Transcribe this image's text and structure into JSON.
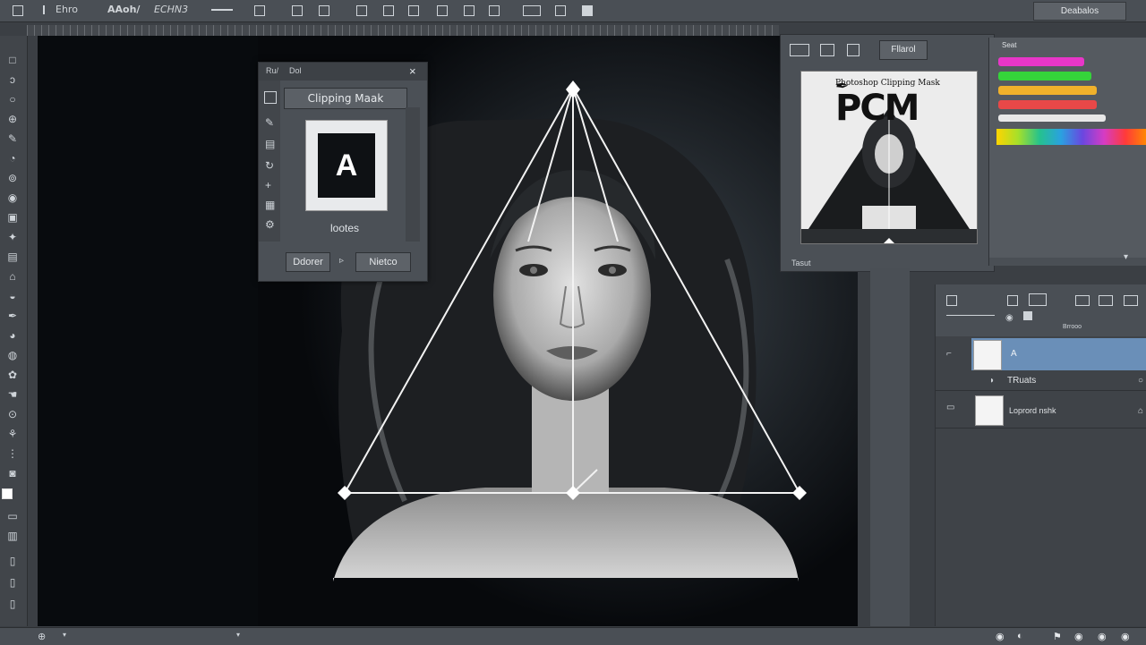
{
  "topbar": {
    "items": [
      "Ehro",
      "AAoh/",
      "ECHN3"
    ],
    "workspace_button": "Deabalos"
  },
  "dialog": {
    "tab_left": "Ru/",
    "tab_right": "Dol",
    "close": "×",
    "title": "Clipping Maak",
    "preview_letter": "A",
    "caption": "lootes",
    "button_left": "Ddorer",
    "button_mid": "▹",
    "button_right": "Nietco"
  },
  "clip_panel": {
    "tab_label": "Fllarol",
    "logo_title": "Photoshop Clipping Mask",
    "logo_text": "PCM",
    "footer": "Tasut"
  },
  "color_panel": {
    "title": "Seat",
    "swatches": [
      "#e836c8",
      "#35d43a",
      "#f0b12b",
      "#e84848",
      "#e8e8e8"
    ]
  },
  "layers": {
    "header_label": "Brrooo",
    "rows": [
      {
        "name": "A",
        "selected": true
      },
      {
        "name": "TRuats",
        "selected": false
      },
      {
        "name": "Loprord nshk",
        "selected": false
      }
    ]
  },
  "colors": {
    "accent": "#6a8fb8",
    "canvas_bg": "#080b0e",
    "panel": "#4b5056"
  }
}
